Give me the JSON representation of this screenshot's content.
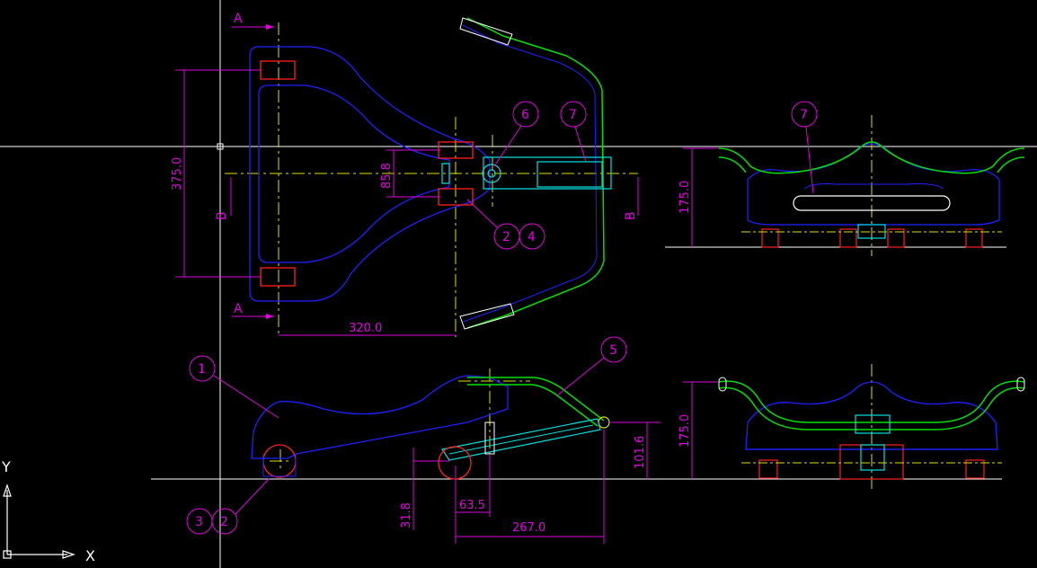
{
  "drawing": {
    "background": "#000000",
    "colors": {
      "outline": "#2020ff",
      "dimension": "#e000e0",
      "centerline": "#e0e000",
      "crosshair": "#ffffff",
      "handlebar": "#00e000",
      "wheel": "#ff2020",
      "insert": "#00e0e0"
    },
    "section_labels": {
      "a_top": "A",
      "a_bottom": "A",
      "b_left": "B",
      "b_right": "B"
    },
    "dimensions": {
      "height_375": "375.0",
      "width_320": "320.0",
      "offset_85": "85.8",
      "height_175_top": "175.0",
      "height_175_bottom": "175.0",
      "height_101": "101.6",
      "offset_31": "31.8",
      "width_63": "63.5",
      "width_267": "267.0"
    },
    "balloons": {
      "b1": "1",
      "b2_top": "2",
      "b4": "4",
      "b5": "5",
      "b6": "6",
      "b7_top": "7",
      "b7_right": "7",
      "b3": "3",
      "b2_bottom": "2"
    },
    "ucs": {
      "x_label": "X",
      "y_label": "Y"
    }
  }
}
